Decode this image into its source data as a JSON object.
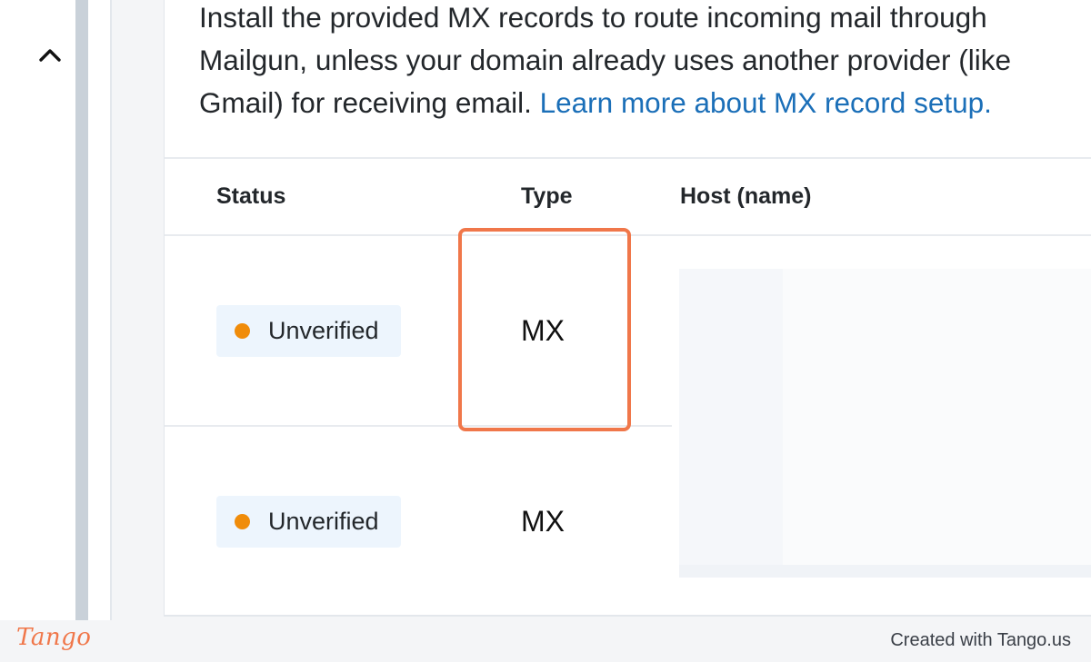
{
  "sidebar": {
    "collapse_icon": "chevron-up-icon"
  },
  "mx_section": {
    "description": "Install the provided MX records to route incoming mail through Mailgun, unless your domain already uses another provider (like Gmail) for receiving email.",
    "learn_more_link": "Learn more about MX record setup."
  },
  "table": {
    "headers": {
      "status": "Status",
      "type": "Type",
      "host": "Host (name)"
    },
    "rows": [
      {
        "status": "Unverified",
        "type": "MX"
      },
      {
        "status": "Unverified",
        "type": "MX"
      }
    ]
  },
  "colors": {
    "status_unverified_dot": "#f08c0a",
    "status_badge_bg": "#edf5fd",
    "link": "#1b6fb8",
    "highlight": "#f0774a"
  },
  "footer": {
    "logo_text": "Tango",
    "created_with": "Created with Tango.us"
  }
}
